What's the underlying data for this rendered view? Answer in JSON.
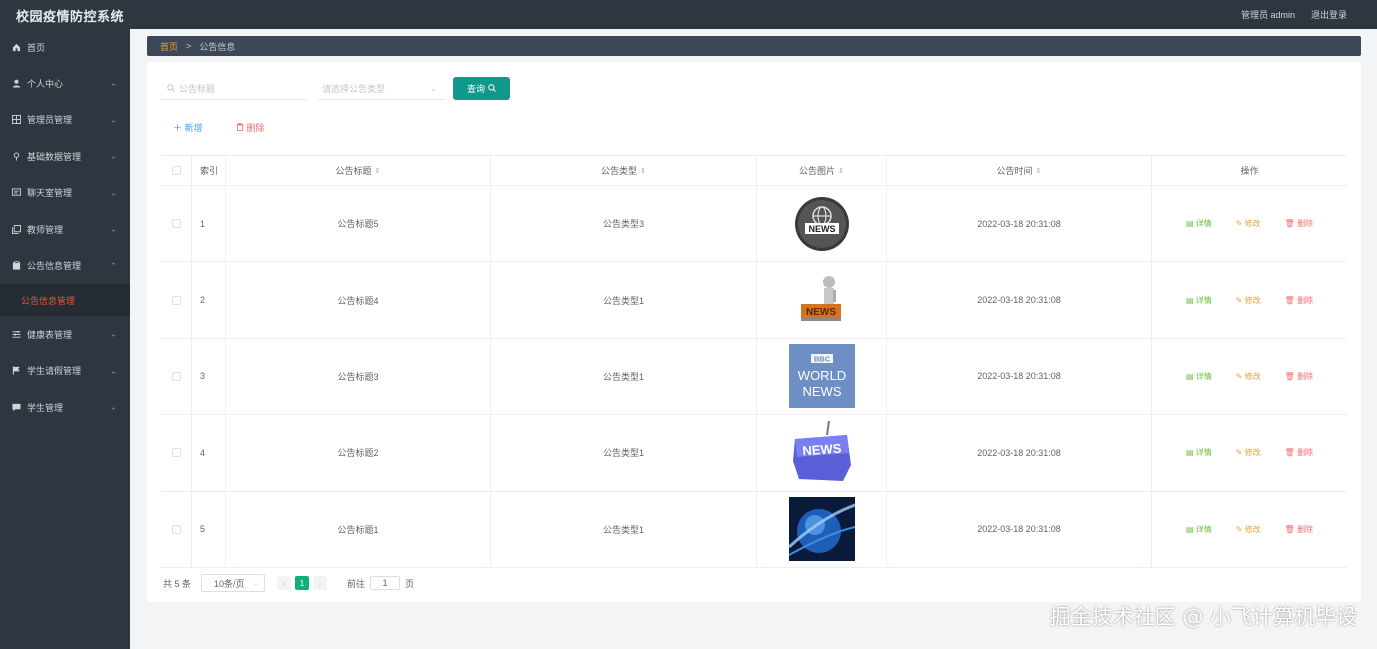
{
  "app": {
    "title": "校园疫情防控系统"
  },
  "header": {
    "user_label": "管理员 admin",
    "logout_label": "退出登录"
  },
  "sidebar": {
    "items": [
      {
        "label": "首页",
        "icon": "home-icon",
        "has_submenu": false
      },
      {
        "label": "个人中心",
        "icon": "user-icon",
        "has_submenu": true
      },
      {
        "label": "管理员管理",
        "icon": "grid-icon",
        "has_submenu": true
      },
      {
        "label": "基础数据管理",
        "icon": "pin-icon",
        "has_submenu": true
      },
      {
        "label": "聊天室管理",
        "icon": "chat-icon",
        "has_submenu": true
      },
      {
        "label": "教师管理",
        "icon": "copy-icon",
        "has_submenu": true
      },
      {
        "label": "公告信息管理",
        "icon": "clipboard-icon",
        "has_submenu": true,
        "expanded": true
      },
      {
        "label": "健康表管理",
        "icon": "sliders-icon",
        "has_submenu": true
      },
      {
        "label": "学生请假管理",
        "icon": "flag-icon",
        "has_submenu": true
      },
      {
        "label": "学生管理",
        "icon": "message-icon",
        "has_submenu": true
      }
    ],
    "active_subitem": "公告信息管理"
  },
  "breadcrumb": {
    "home": "首页",
    "separator": ">",
    "current": "公告信息"
  },
  "search": {
    "title_placeholder": "公告标题",
    "type_placeholder": "请选择公告类型",
    "query_label": "查询"
  },
  "actions": {
    "add_label": "新增",
    "delete_label": "删除"
  },
  "table": {
    "columns": [
      "索引",
      "公告标题",
      "公告类型",
      "公告图片",
      "公告时间",
      "操作"
    ],
    "rows": [
      {
        "index": "1",
        "title": "公告标题5",
        "type": "公告类型3",
        "image": "news-globe-image",
        "time": "2022-03-18 20:31:08"
      },
      {
        "index": "2",
        "title": "公告标题4",
        "type": "公告类型1",
        "image": "news-3d-man-image",
        "time": "2022-03-18 20:31:08"
      },
      {
        "index": "3",
        "title": "公告标题3",
        "type": "公告类型1",
        "image": "bbc-world-news-image",
        "time": "2022-03-18 20:31:08"
      },
      {
        "index": "4",
        "title": "公告标题2",
        "type": "公告类型1",
        "image": "news-key-image",
        "time": "2022-03-18 20:31:08"
      },
      {
        "index": "5",
        "title": "公告标题1",
        "type": "公告类型1",
        "image": "news-blue-globe-image",
        "time": "2022-03-18 20:31:08"
      }
    ],
    "row_actions": {
      "detail": "详情",
      "edit": "修改",
      "delete": "删除"
    }
  },
  "pagination": {
    "total_label": "共 5 条",
    "page_size": "10条/页",
    "current_page": "1",
    "goto_label": "前往",
    "goto_value": "1",
    "page_unit": "页"
  },
  "bbc_image_text": {
    "line1": "BBC",
    "line2": "WORLD",
    "line3": "NEWS"
  },
  "news_image_text": "NEWS",
  "watermark": "掘金技术社区 @ 小飞计算机毕设",
  "colors": {
    "sidebar_bg": "#2e3640",
    "active_menu": "#e8553a",
    "query_button": "#10988c",
    "breadcrumb_bg": "#3c4757",
    "pager_active": "#10b07a"
  }
}
